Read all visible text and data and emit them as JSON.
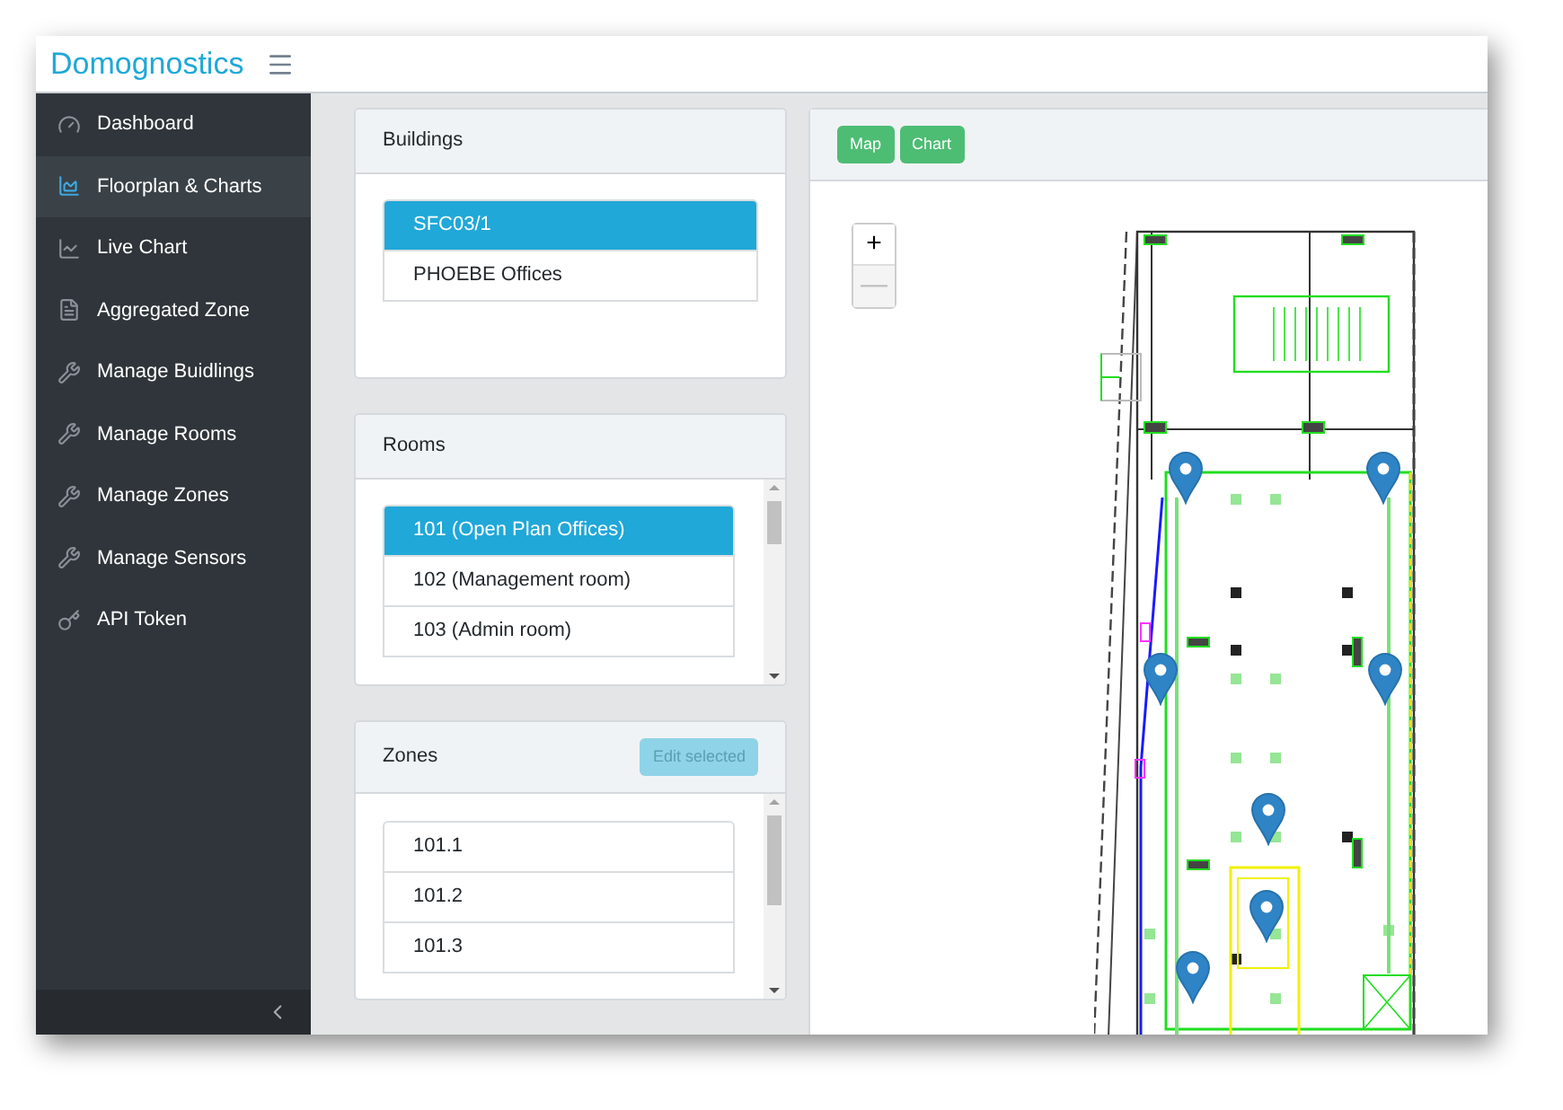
{
  "header": {
    "title": "Domognostics"
  },
  "sidebar": {
    "items": [
      {
        "label": "Dashboard",
        "kind": "gauge",
        "selected": false
      },
      {
        "label": "Floorplan & Charts",
        "kind": "area",
        "selected": true
      },
      {
        "label": "Live Chart",
        "kind": "line",
        "selected": false
      },
      {
        "label": "Aggregated Zone",
        "kind": "file",
        "selected": false
      },
      {
        "label": "Manage Buidlings",
        "kind": "wrench",
        "selected": false
      },
      {
        "label": "Manage Rooms",
        "kind": "wrench",
        "selected": false
      },
      {
        "label": "Manage Zones",
        "kind": "wrench",
        "selected": false
      },
      {
        "label": "Manage Sensors",
        "kind": "wrench",
        "selected": false
      },
      {
        "label": "API Token",
        "kind": "key",
        "selected": false
      }
    ]
  },
  "buildings": {
    "title": "Buildings",
    "items": [
      {
        "label": "SFC03/1",
        "selected": true
      },
      {
        "label": "PHOEBE Offices",
        "selected": false
      }
    ]
  },
  "rooms": {
    "title": "Rooms",
    "items": [
      {
        "label": "101 (Open Plan Offices)",
        "selected": true
      },
      {
        "label": "102 (Management room)",
        "selected": false
      },
      {
        "label": "103 (Admin room)",
        "selected": false
      }
    ]
  },
  "zones": {
    "title": "Zones",
    "edit_button": {
      "label": "Edit selected",
      "disabled": true
    },
    "items": [
      {
        "label": "101.1",
        "selected": false
      },
      {
        "label": "101.2",
        "selected": false
      },
      {
        "label": "101.3",
        "selected": false
      }
    ]
  },
  "map_panel": {
    "buttons": [
      "Map",
      "Chart"
    ],
    "zoom_in": {
      "label": "+",
      "disabled": false
    },
    "zoom_out": {
      "label": "—",
      "disabled": true
    }
  }
}
